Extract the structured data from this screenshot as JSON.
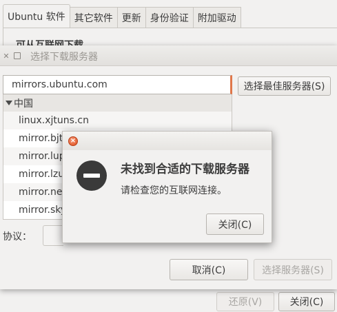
{
  "main_window": {
    "tabs": [
      {
        "label": "Ubuntu 软件"
      },
      {
        "label": "其它软件"
      },
      {
        "label": "更新"
      },
      {
        "label": "身份验证"
      },
      {
        "label": "附加驱动"
      }
    ],
    "section_heading": "可从互联网下载",
    "revert_label": "还原(V)",
    "close_label": "关闭(C)"
  },
  "server_dialog": {
    "title": "选择下载服务器",
    "selected_server": "mirrors.ubuntu.com",
    "best_server_label": "选择最佳服务器(S)",
    "group_label": "中国",
    "servers": [
      "linux.xjtuns.cn",
      "mirror.bjtu.edu.cn",
      "mirror.lupaworld.com",
      "mirror.lzu.edu.cn",
      "mirror.neu.edu.cn",
      "mirror.sky-mirror.com"
    ],
    "protocol_label": "协议：",
    "cancel_label": "取消(C)",
    "choose_label": "选择服务器(S)"
  },
  "error_dialog": {
    "title": "未找到合适的下载服务器",
    "message": "请检查您的互联网连接。",
    "close_label": "关闭(C)"
  },
  "icons": {
    "error": "no-entry-icon",
    "window_close": "close-icon",
    "window_maximize": "maximize-icon",
    "expander": "triangle-down-icon"
  },
  "colors": {
    "close_button": "#df4b16",
    "input_focus": "#e0774a"
  }
}
